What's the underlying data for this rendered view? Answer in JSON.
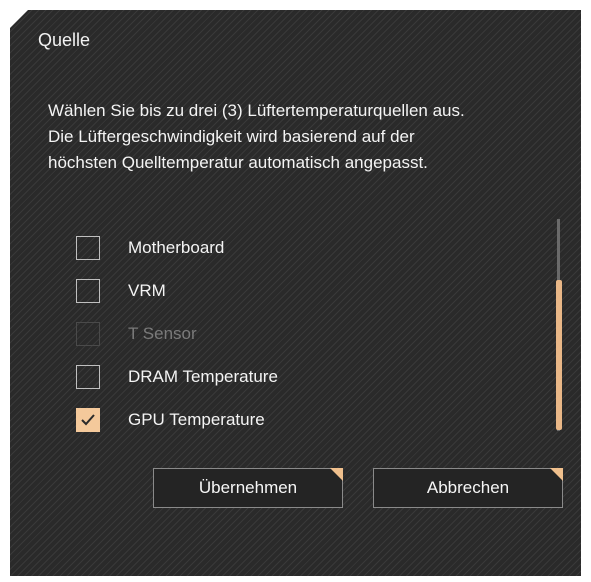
{
  "dialog": {
    "title": "Quelle",
    "description_lines": [
      "Wählen Sie bis zu drei (3) Lüftertemperaturquellen aus.",
      "Die Lüftergeschwindigkeit wird basierend auf der",
      "höchsten Quelltemperatur automatisch angepasst."
    ]
  },
  "sources": [
    {
      "label": "Motherboard",
      "checked": false,
      "disabled": false
    },
    {
      "label": "VRM",
      "checked": false,
      "disabled": false
    },
    {
      "label": "T Sensor",
      "checked": false,
      "disabled": true
    },
    {
      "label": "DRAM Temperature",
      "checked": false,
      "disabled": false
    },
    {
      "label": "GPU Temperature",
      "checked": true,
      "disabled": false
    }
  ],
  "buttons": {
    "apply": "Übernehmen",
    "cancel": "Abbrechen"
  },
  "colors": {
    "accent": "#f4c99b",
    "background": "#2a2a2a"
  }
}
